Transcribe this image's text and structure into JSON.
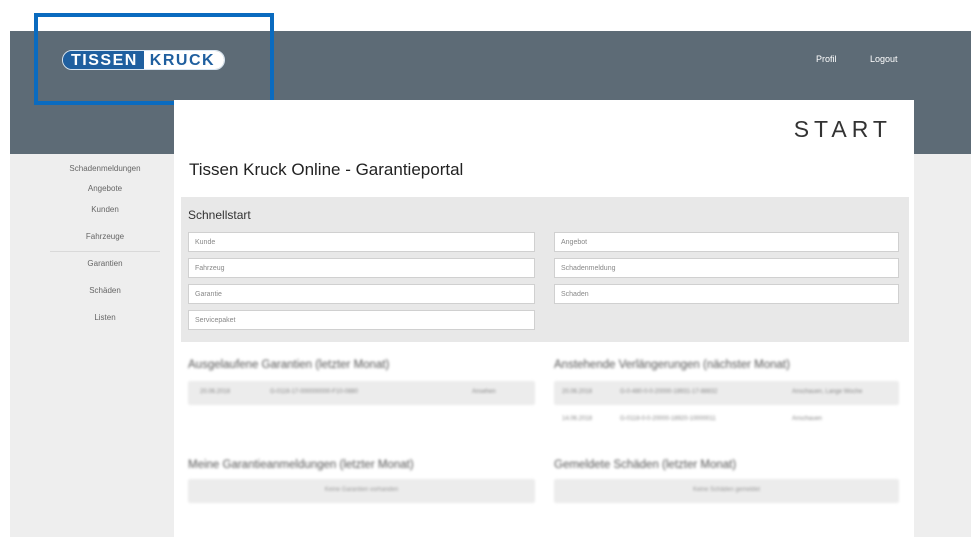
{
  "brand": {
    "part1": "TISSEN",
    "part2": "KRUCK"
  },
  "colors": {
    "header": "#5d6b76",
    "logo_blue": "#1f5f9f",
    "highlight": "#0a6bbf"
  },
  "nav": {
    "profile": "Profil",
    "logout": "Logout"
  },
  "sidebar": {
    "items": [
      {
        "label": "Schadenmeldungen"
      },
      {
        "label": "Angebote"
      },
      {
        "label": "Kunden"
      },
      {
        "label": "Fahrzeuge"
      },
      {
        "label": "Garantien"
      },
      {
        "label": "Schäden"
      },
      {
        "label": "Listen"
      }
    ]
  },
  "main": {
    "start": "START",
    "title": "Tissen Kruck Online - Garantieportal"
  },
  "quickstart": {
    "title": "Schnellstart",
    "fields": [
      {
        "placeholder": "Kunde"
      },
      {
        "placeholder": "Fahrzeug"
      },
      {
        "placeholder": "Garantie"
      },
      {
        "placeholder": "Servicepaket"
      },
      {
        "placeholder": "Angebot"
      },
      {
        "placeholder": "Schadenmeldung"
      },
      {
        "placeholder": "Schaden"
      }
    ]
  },
  "sections": {
    "expired": {
      "title": "Ausgelaufene Garantien (letzter Monat)",
      "rows": [
        {
          "date": "20.06.2018",
          "id": "G-0116-17-000000000-F10-0880",
          "action": "Ansehen"
        }
      ]
    },
    "renewals": {
      "title": "Anstehende Verlängerungen (nächster Monat)",
      "rows": [
        {
          "date": "20.06.2018",
          "id": "G-0-480-0-0-20000-18931-17-88832",
          "action": "Anschauen, Lange Woche"
        },
        {
          "date": "14.06.2018",
          "id": "G-0118-0-0-20000-18920-10000011",
          "action": "Anschauen"
        }
      ]
    },
    "registrations": {
      "title": "Meine Garantieanmeldungen (letzter Monat)",
      "empty": "Keine Garantien vorhanden"
    },
    "claims": {
      "title": "Gemeldete Schäden (letzter Monat)",
      "empty": "Keine Schäden gemeldet"
    }
  }
}
